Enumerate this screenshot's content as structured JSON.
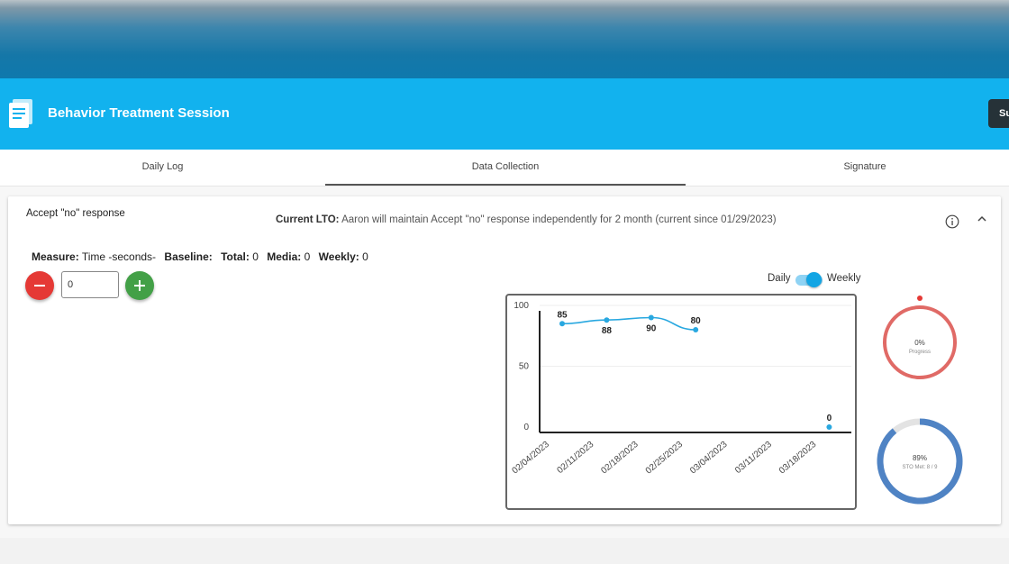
{
  "header": {
    "title": "Behavior Treatment Session",
    "submit_label": "Su"
  },
  "tabs": [
    {
      "label": "Daily Log"
    },
    {
      "label": "Data Collection"
    },
    {
      "label": "Signature"
    }
  ],
  "goal": {
    "name": "Accept \"no\" response",
    "current_lto_label": "Current LTO:",
    "current_lto_text": "Aaron will maintain Accept \"no\" response independently for 2 month (current since 01/29/2023)"
  },
  "measure": {
    "measure_label": "Measure:",
    "measure_value": "Time -seconds-",
    "baseline_label": "Baseline:",
    "baseline_value": "",
    "total_label": "Total:",
    "total_value": "0",
    "media_label": "Media:",
    "media_value": "0",
    "weekly_label": "Weekly:",
    "weekly_value": "0"
  },
  "counter": {
    "value": "0"
  },
  "toggle": {
    "left_label": "Daily",
    "right_label": "Weekly",
    "selected": "Weekly"
  },
  "chart_data": {
    "type": "line",
    "categories": [
      "02/04/2023",
      "02/11/2023",
      "02/18/2023",
      "02/25/2023",
      "03/04/2023",
      "03/11/2023",
      "03/18/2023"
    ],
    "series": [
      {
        "values": [
          85,
          88,
          90,
          80,
          null,
          null,
          0
        ]
      }
    ],
    "ylim": [
      0,
      100
    ],
    "yticks": [
      0,
      50,
      100
    ],
    "data_labels": [
      "85",
      "88",
      "90",
      "80",
      "",
      "",
      "0"
    ],
    "colors": {
      "line": "#29a8e0"
    }
  },
  "progress_ring": {
    "value_text": "0%",
    "label": "Progress",
    "fraction": 0.0,
    "color": "#e06a66"
  },
  "sto_ring": {
    "value_text": "89%",
    "label": "STO Met: 8 / 9",
    "fraction": 0.89,
    "color": "#4f83c4"
  }
}
